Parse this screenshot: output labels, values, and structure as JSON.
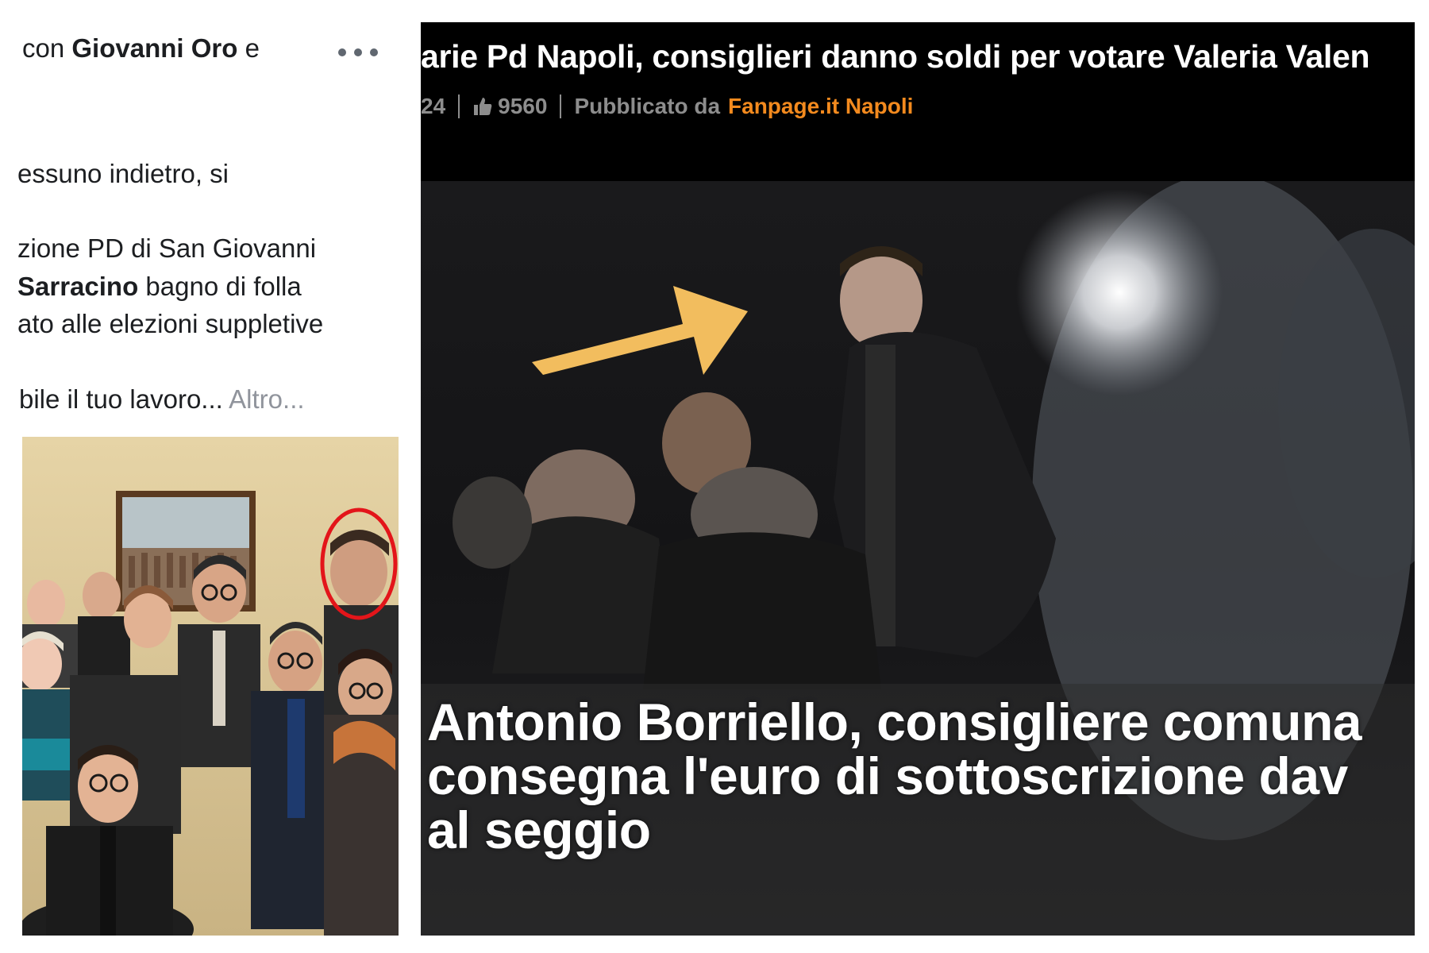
{
  "left_post": {
    "tag_prefix": "con ",
    "tag_name": "Giovanni Oro",
    "tag_suffix": " e",
    "line_1": "essuno indietro, si",
    "line_2": "zione PD di San Giovanni",
    "line_3_bold": "Sarracino",
    "line_3_rest": " bagno di folla",
    "line_4": "ato alle elezioni suppletive",
    "line_5": "bile il tuo lavoro...",
    "more_link": "Altro...",
    "more_icon": "more-horizontal-icon",
    "highlight_color": "#e3151a"
  },
  "video": {
    "title": "arie Pd Napoli, consiglieri danno soldi per votare Valeria Valen",
    "views_partial": "24",
    "likes": "9560",
    "published_label": "Pubblicato da",
    "publisher": "Fanpage.it Napoli",
    "publisher_color": "#f38a1e",
    "like_icon": "thumbs-up-icon",
    "arrow_color": "#f2bd5e",
    "caption": {
      "line_1": "Antonio Borriello, consigliere comuna",
      "line_2": "consegna l'euro di sottoscrizione dav",
      "line_3": "al seggio"
    }
  }
}
